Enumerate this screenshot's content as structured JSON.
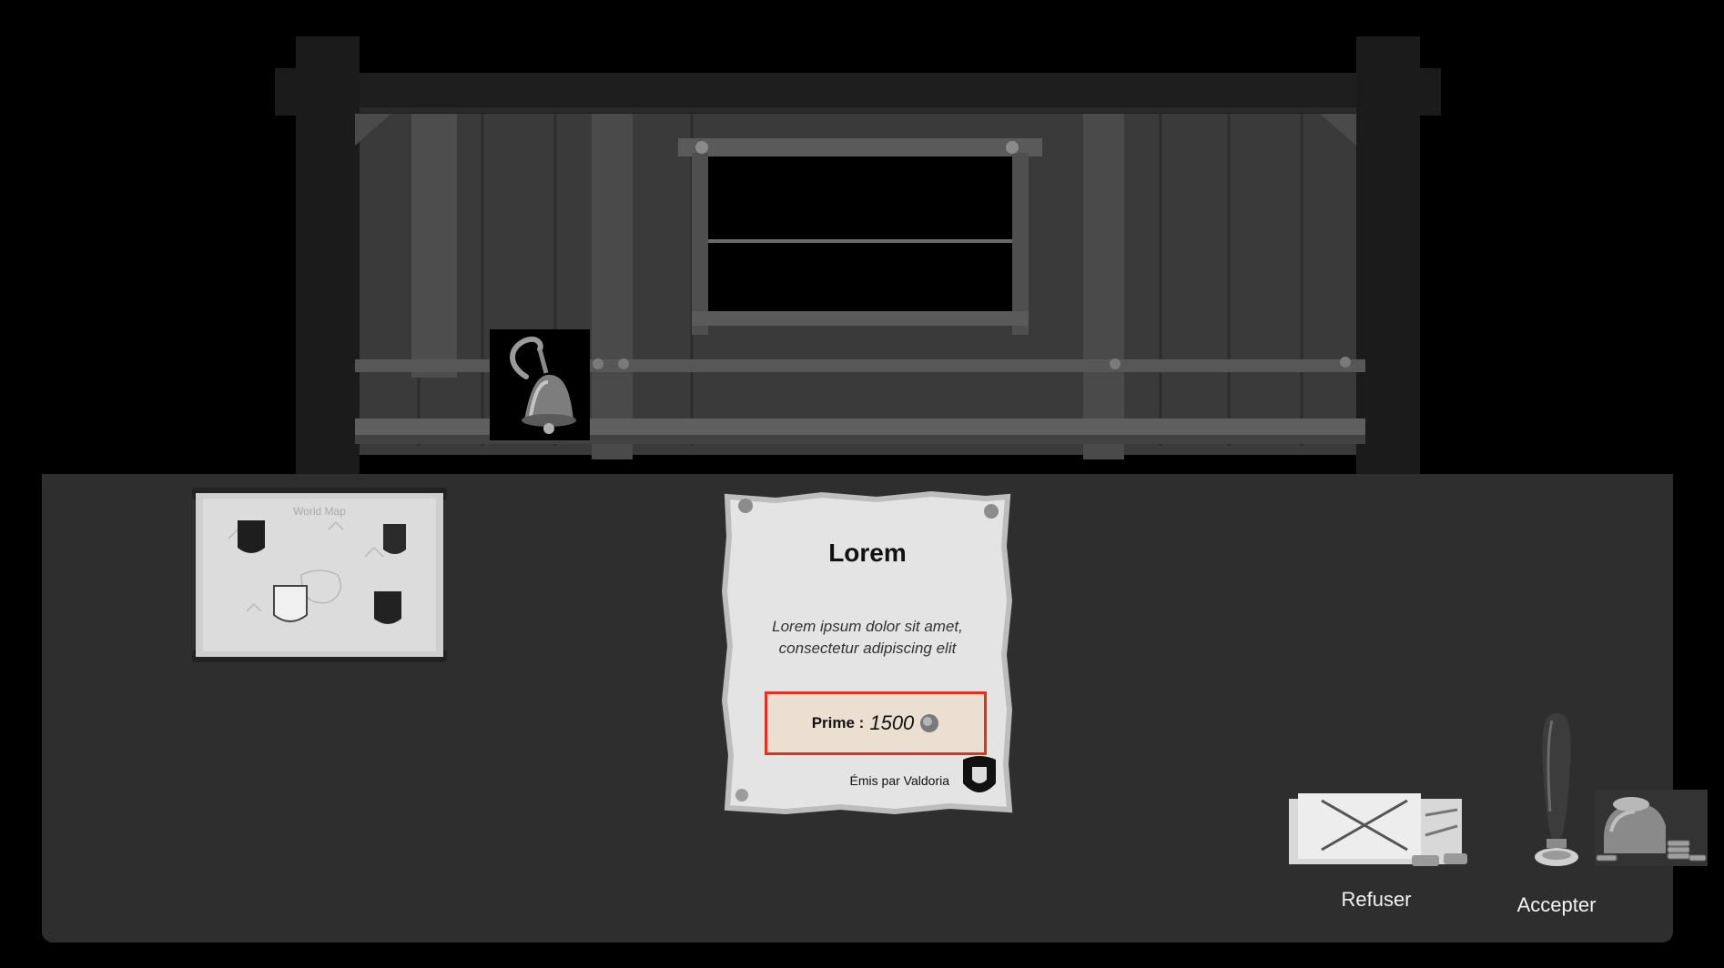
{
  "scene": {
    "stall_name": "wooden-stall",
    "bell_icon": "bell-icon",
    "world_map_icon": "world-map-icon",
    "world_map_title": "World Map"
  },
  "quest": {
    "title": "Lorem",
    "description": "Lorem ipsum dolor sit amet, consectetur adipiscing elit",
    "reward_label": "Prime :",
    "reward_value": "1500",
    "reward_icon": "coin-icon",
    "issuer": "Émis par Valdoria",
    "issuer_icon": "crest-icon",
    "highlight_color": "#e5311b"
  },
  "actions": {
    "refuse_label": "Refuser",
    "refuse_icon": "crossed-letter-icon",
    "accept_label": "Accepter",
    "accept_icon": "wax-stamp-icon"
  },
  "colors": {
    "background": "#000000",
    "desk": "#2e2e2e",
    "parchment": "#e4e4e4",
    "reward_box": "#eadfd1",
    "label_text": "#f2f2f2"
  }
}
